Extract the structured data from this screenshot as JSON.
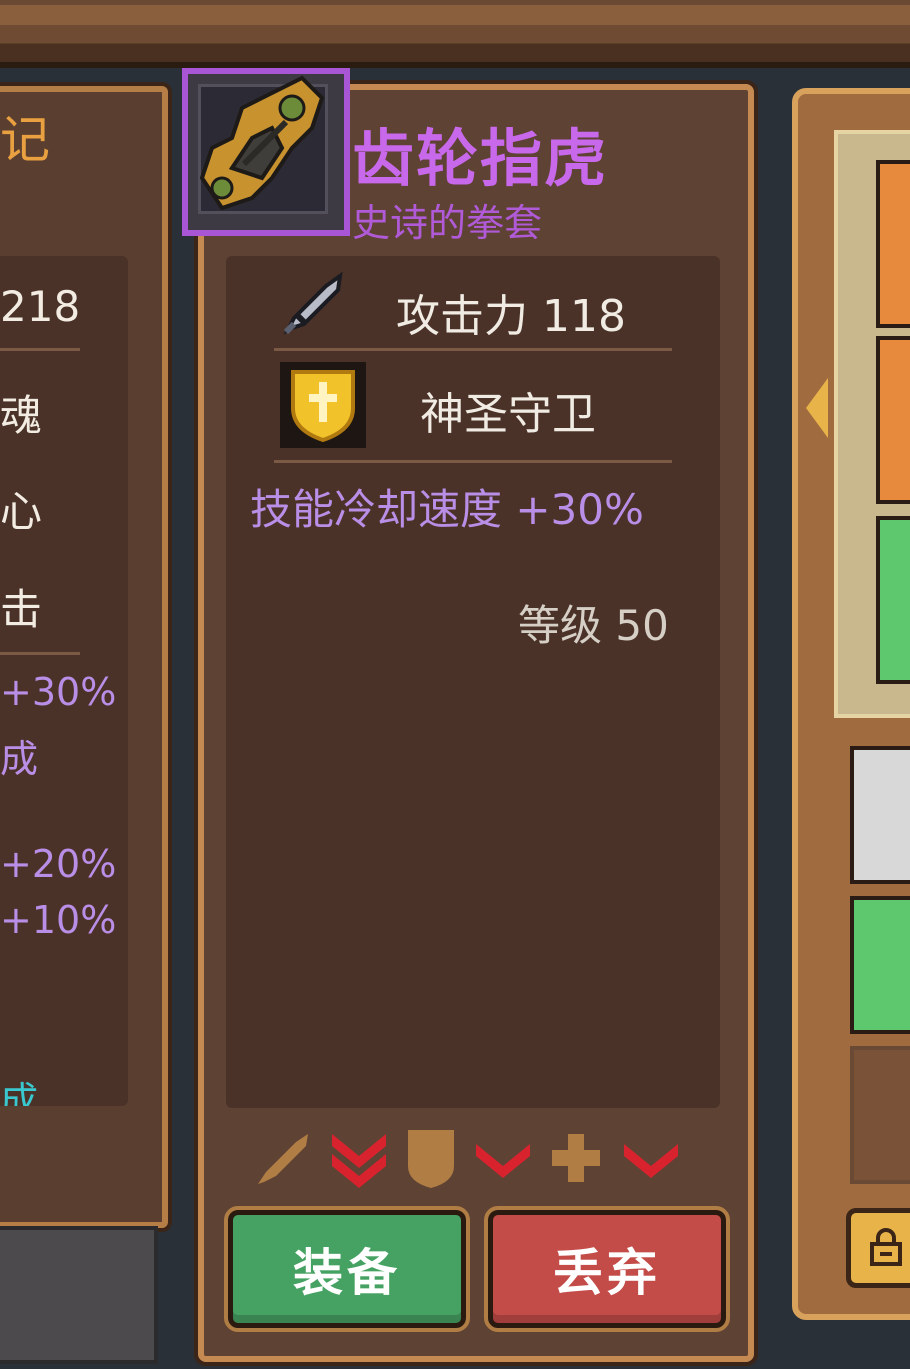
{
  "item": {
    "name": "齿轮指虎",
    "subtitle": "史诗的拳套",
    "attack": "攻击力 118",
    "skill": "神圣守卫",
    "bonus": "技能冷却速度 +30%",
    "level": "等级 50"
  },
  "buttons": {
    "equip": "装备",
    "discard": "丢弃"
  },
  "left_panel": {
    "header_fragment": "记",
    "stat_value": "218",
    "line1": "魂",
    "line2": "心",
    "line3": "击",
    "bonus1": "+30%",
    "line4": "成",
    "bonus2": "+20%",
    "bonus3": "+10%",
    "footer_fragment": "成"
  },
  "colors": {
    "epic": "#c868ea",
    "bonus": "#b98ee6",
    "equip": "#46a262",
    "discard": "#c34c49",
    "red_chevron": "#d8232e"
  }
}
